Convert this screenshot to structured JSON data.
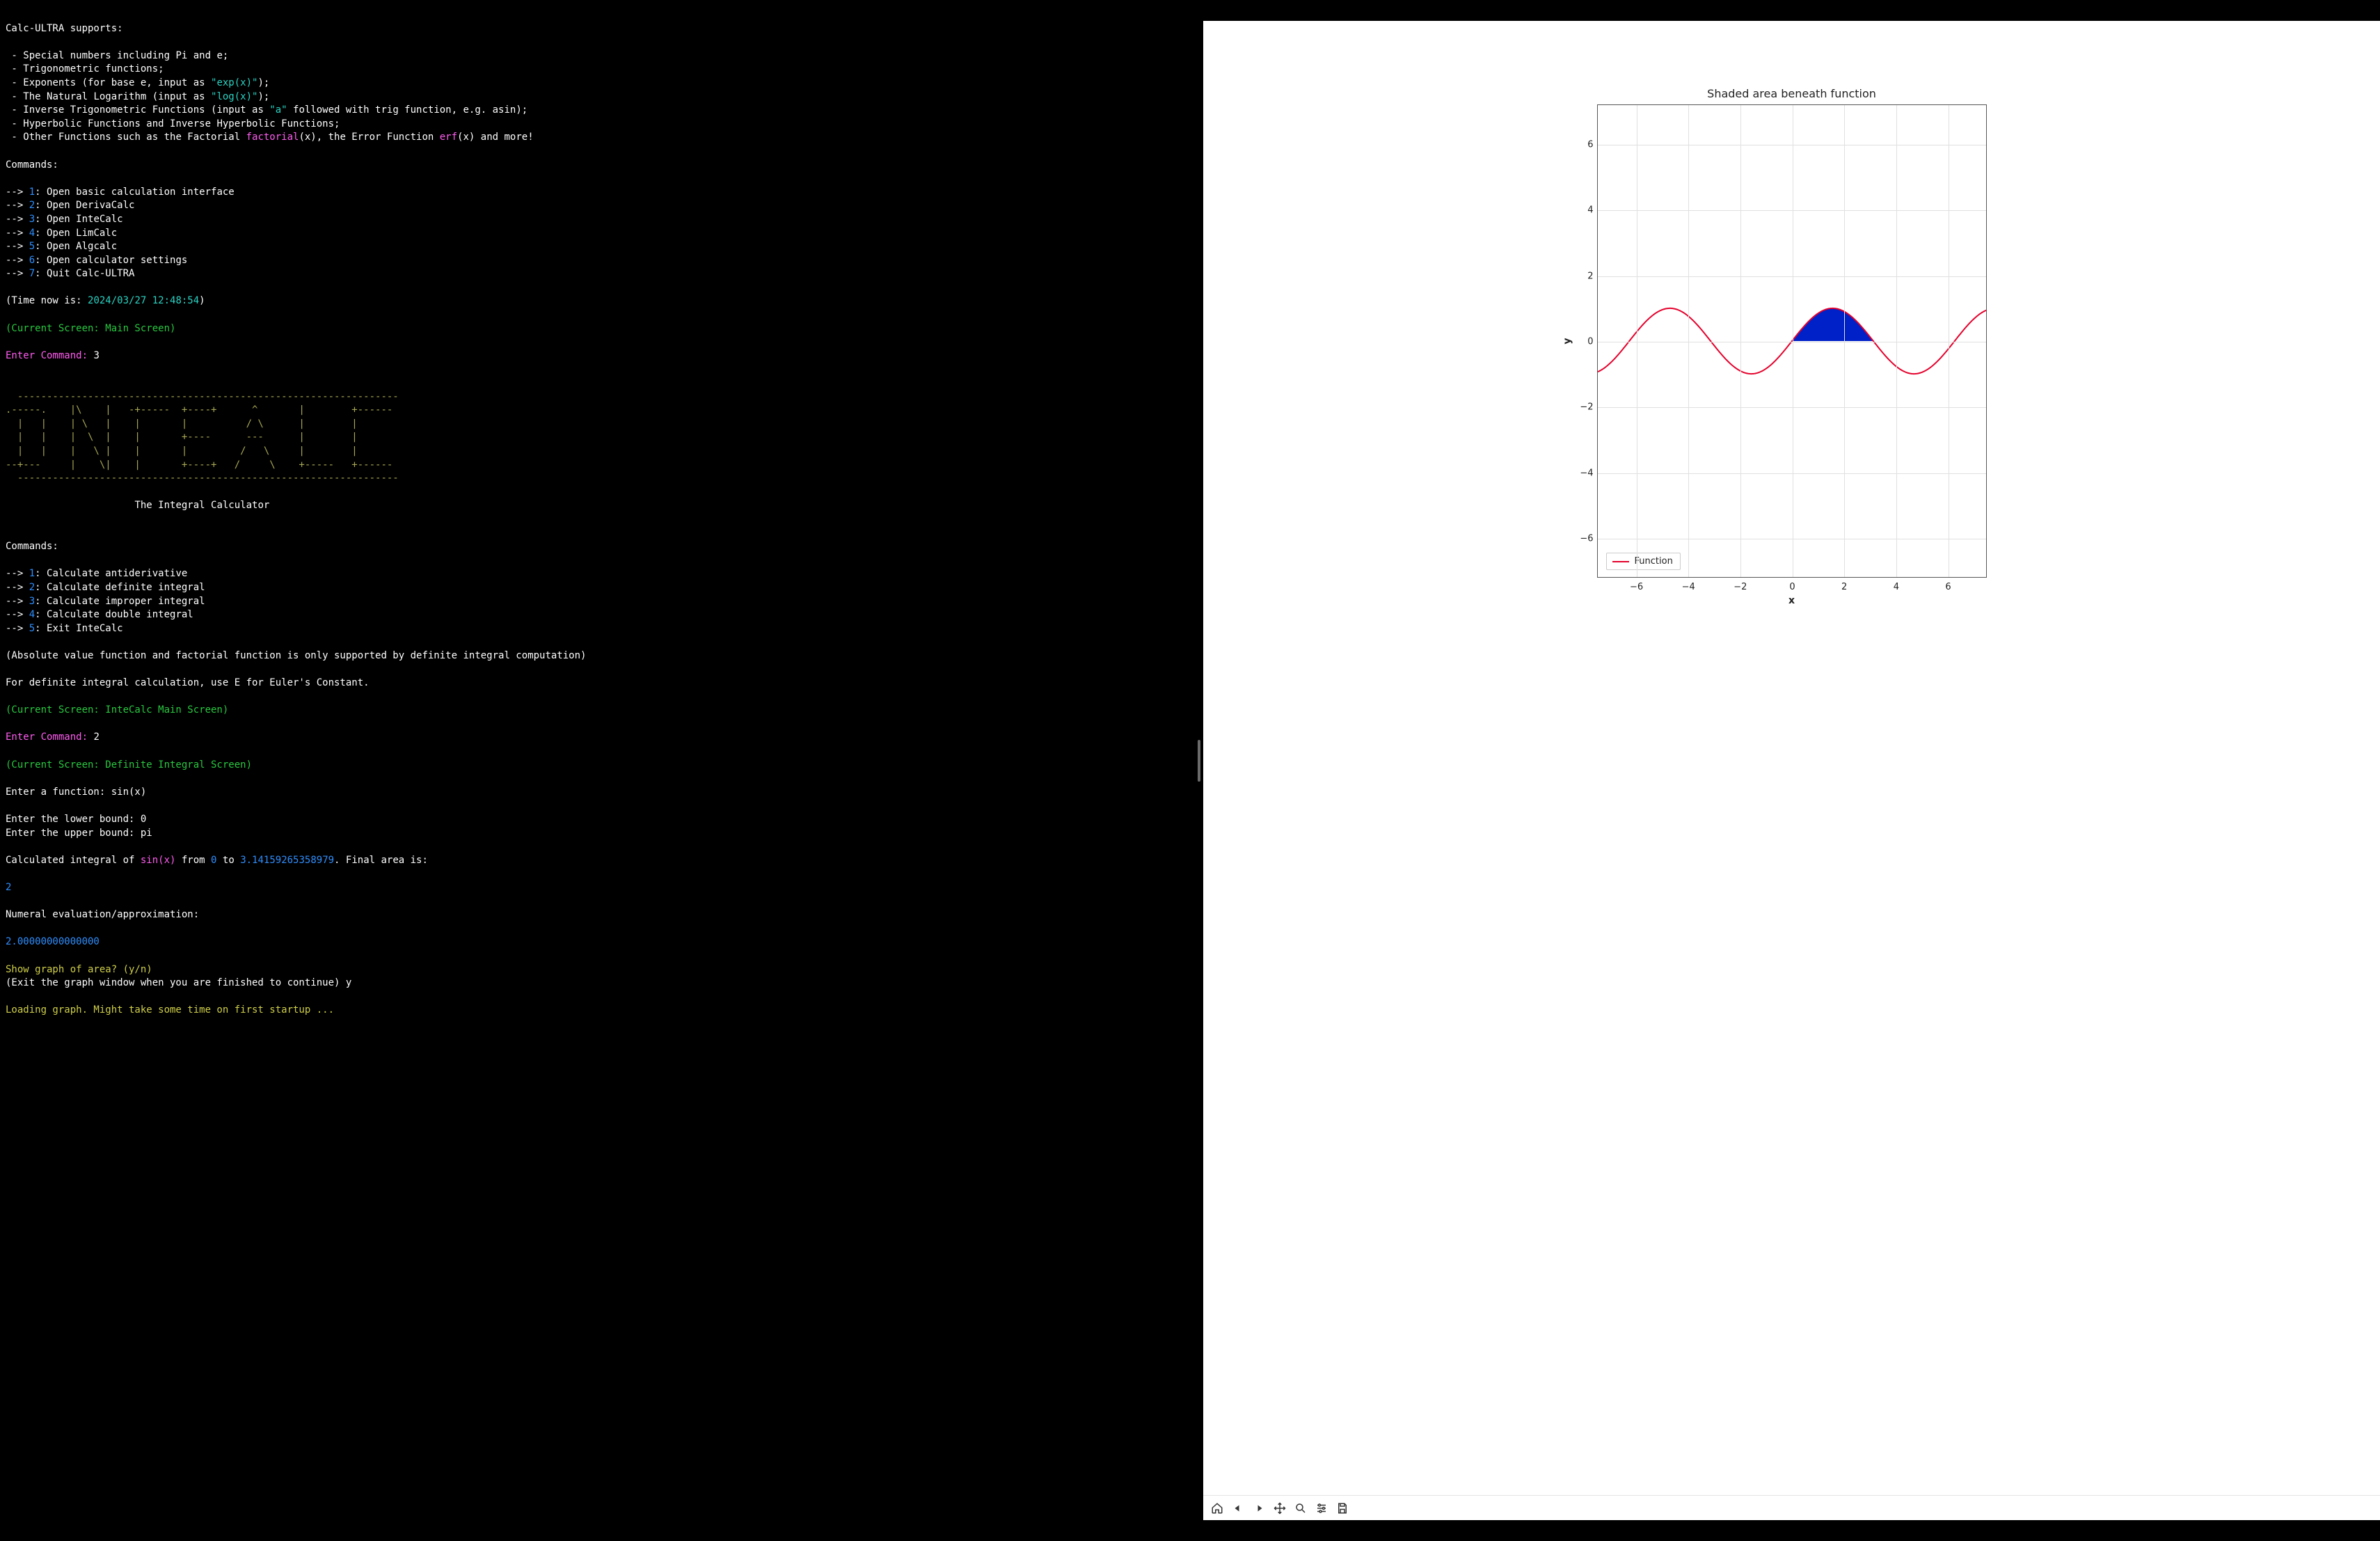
{
  "terminal": {
    "supports_heading": "Calc-ULTRA supports:",
    "supports": [
      "Special numbers including Pi and e;",
      "Trigonometric functions;",
      "Exponents (for base e, input as ",
      "The Natural Logarithm (input as ",
      "Inverse Trigonometric Functions (input as ",
      "Hyperbolic Functions and Inverse Hyperbolic Functions;",
      "Other Functions such as the Factorial "
    ],
    "exp_token": "\"exp(x)\"",
    "log_token": "\"log(x)\"",
    "a_token": "\"a\"",
    "inv_trig_suffix": " followed with trig function, e.g. asin);",
    "factorial_token": "factorial",
    "other_mid": "(x), the Error Function ",
    "erf_token": "erf",
    "other_tail": "(x) and more!",
    "exp_tail": ");",
    "log_tail": ");",
    "commands_label": "Commands:",
    "arrow": "--> ",
    "menu": [
      {
        "n": "1",
        "label": "Open basic calculation interface"
      },
      {
        "n": "2",
        "label": "Open DerivaCalc"
      },
      {
        "n": "3",
        "label": "Open InteCalc"
      },
      {
        "n": "4",
        "label": "Open LimCalc"
      },
      {
        "n": "5",
        "label": "Open Algcalc"
      },
      {
        "n": "6",
        "label": "Open calculator settings"
      },
      {
        "n": "7",
        "label": "Quit Calc-ULTRA"
      }
    ],
    "time_prefix": "(Time now is: ",
    "time_value": "2024/03/27 12:48:54",
    "time_suffix": ")",
    "screen_main": "(Current Screen: Main Screen)",
    "enter_cmd": "Enter Command: ",
    "entered_3": "3",
    "ascii_banner": "  -----------------------------------------------------------------\n.-----.    |\\    |   -+-----  +----+      ^       |        +------\n  |   |    | \\   |    |       |          / \\      |        |      \n  |   |    |  \\  |    |       +----      ---      |        |      \n  |   |    |   \\ |    |       |         /   \\     |        |      \n--+---     |    \\|    |       +----+   /     \\    +-----   +------\n  -----------------------------------------------------------------",
    "integral_title": "The Integral Calculator",
    "intecalc_menu": [
      {
        "n": "1",
        "label": "Calculate antiderivative"
      },
      {
        "n": "2",
        "label": "Calculate definite integral"
      },
      {
        "n": "3",
        "label": "Calculate improper integral"
      },
      {
        "n": "4",
        "label": "Calculate double integral"
      },
      {
        "n": "5",
        "label": "Exit InteCalc"
      }
    ],
    "absnote": "(Absolute value function and factorial function is only supported by definite integral computation)",
    "euler_note": "For definite integral calculation, use E for Euler's Constant.",
    "screen_intecalc": "(Current Screen: InteCalc Main Screen)",
    "entered_2": "2",
    "screen_definite": "(Current Screen: Definite Integral Screen)",
    "enter_func_label": "Enter a function: ",
    "enter_func_val": "sin(x)",
    "enter_lower": "Enter the lower bound: 0",
    "enter_upper": "Enter the upper bound: pi",
    "calc_prefix": "Calculated integral of ",
    "sinx_token": "sin(x)",
    "from_token": " from ",
    "zero_token": "0",
    "to_token": " to ",
    "pi_token": "3.14159265358979",
    "final_area": ". Final area is:",
    "result": "2",
    "numeral": "Numeral evaluation/approximation:",
    "numeral_val": "2.00000000000000",
    "show_graph": "Show graph of area? (y/n)",
    "exit_note": "(Exit the graph window when you are finished to continue) y",
    "loading": "Loading graph. Might take some time on first startup ..."
  },
  "chart_data": {
    "type": "line",
    "title": "Shaded area beneath function",
    "xlabel": "x",
    "ylabel": "y",
    "xlim": [
      -7.5,
      7.5
    ],
    "ylim": [
      -7.2,
      7.2
    ],
    "xticks": [
      -6,
      -4,
      -2,
      0,
      2,
      4,
      6
    ],
    "yticks": [
      -6,
      -4,
      -2,
      0,
      2,
      4,
      6
    ],
    "series": [
      {
        "name": "Function",
        "color": "#e4002b",
        "function": "sin(x)"
      }
    ],
    "shaded_region": {
      "from": 0,
      "to": 3.14159265358979,
      "color": "#0020c8"
    },
    "legend": {
      "position": "lower-left",
      "entries": [
        "Function"
      ]
    }
  },
  "toolbar": {
    "home": "Home",
    "back": "Back",
    "forward": "Forward",
    "pan": "Pan",
    "zoom": "Zoom",
    "configure": "Configure subplots",
    "save": "Save"
  }
}
